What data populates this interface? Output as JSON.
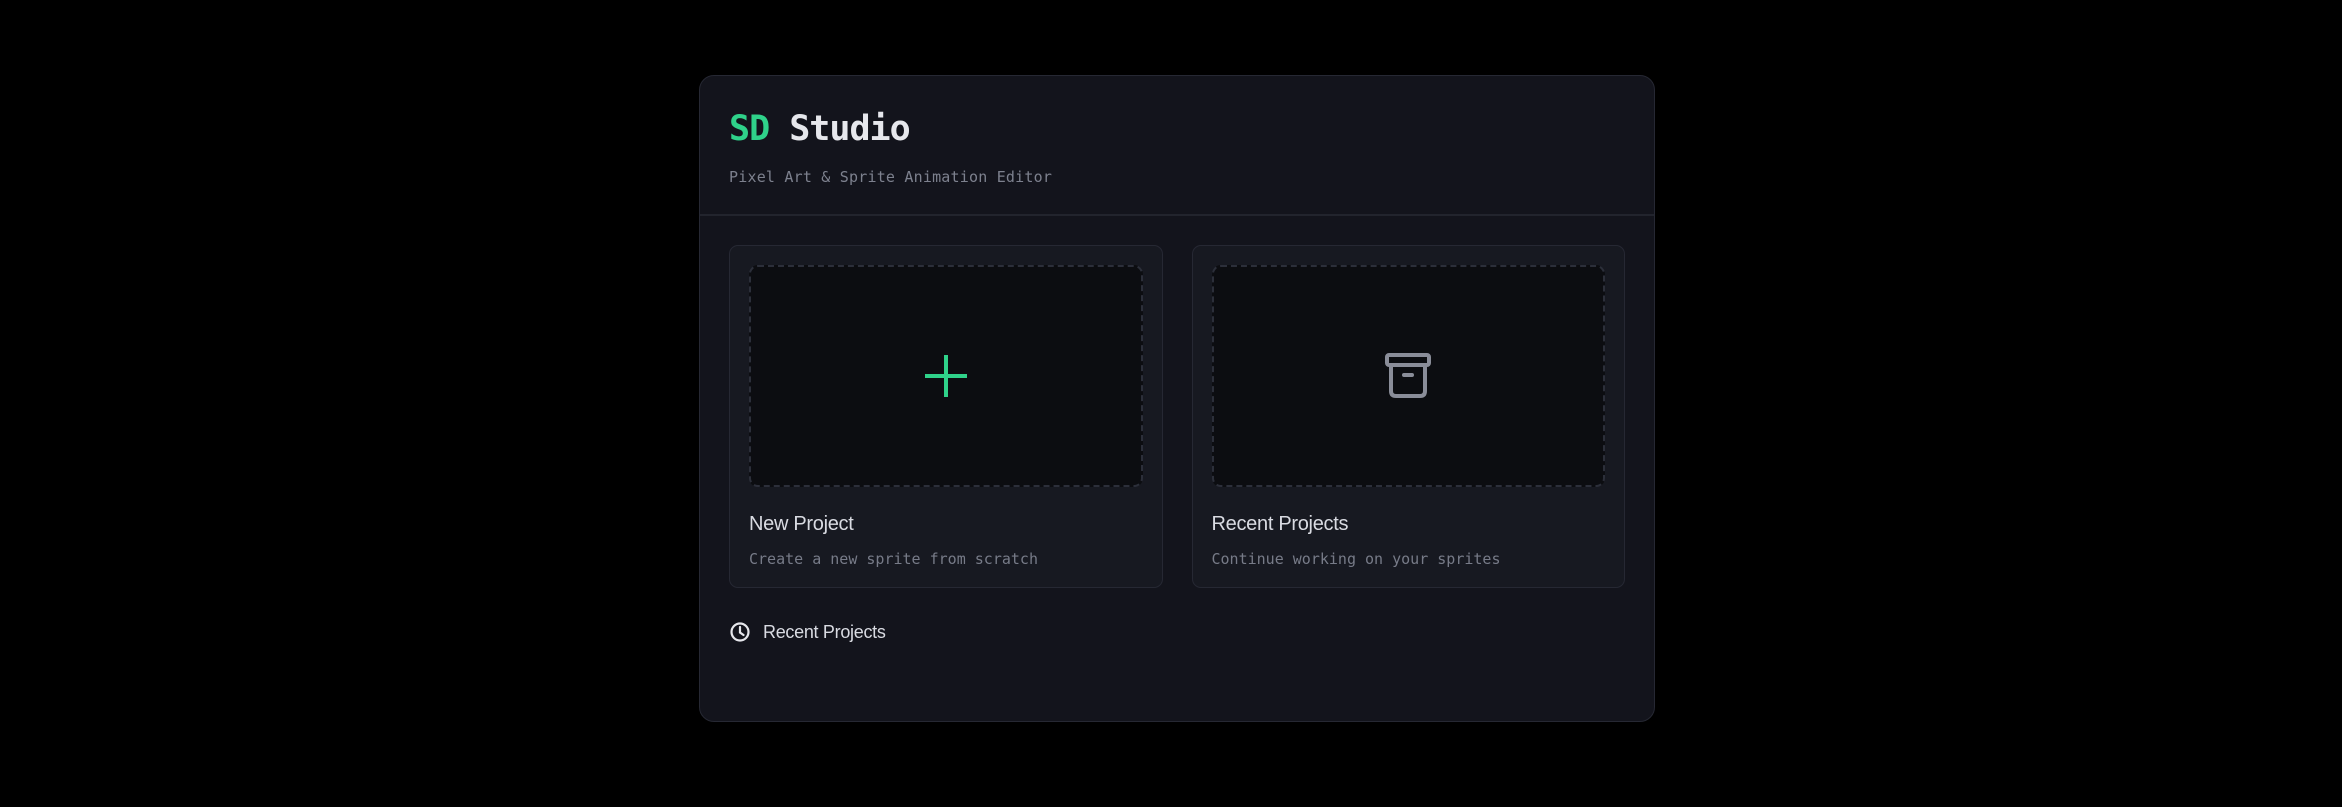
{
  "app": {
    "title_accent": "SD",
    "title_main": "Studio",
    "subtitle": "Pixel Art & Sprite Animation Editor"
  },
  "cards": [
    {
      "title": "New Project",
      "description": "Create a new sprite from scratch",
      "icon": "plus-icon"
    },
    {
      "title": "Recent Projects",
      "description": "Continue working on your sprites",
      "icon": "archive-box-icon"
    }
  ],
  "recent_section": {
    "label": "Recent Projects",
    "icon": "clock-icon"
  },
  "colors": {
    "background": "#000000",
    "panel": "#13141c",
    "accent_green": "#2fd28a",
    "icon_gray": "#8a8d99"
  }
}
